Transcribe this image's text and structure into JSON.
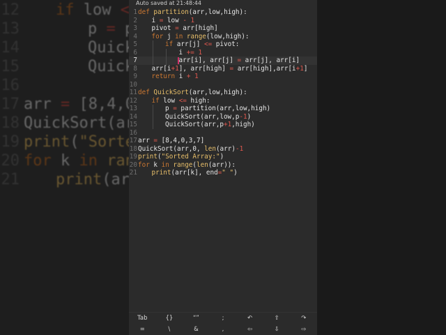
{
  "status": {
    "autosave": "Auto saved at 21:48:44"
  },
  "editor": {
    "active_line": 7,
    "colors": {
      "background": "#2b2b2b",
      "keyword": "#cc7832",
      "function": "#e8bf6a",
      "operator": "#e0584e"
    },
    "lines": [
      {
        "n": "1",
        "indent": 0,
        "tokens": [
          [
            "def ",
            "kw"
          ],
          [
            "partition",
            "fn"
          ],
          [
            "(arr,low,high):",
            ""
          ]
        ]
      },
      {
        "n": "2",
        "indent": 1,
        "tokens": [
          [
            "i ",
            ""
          ],
          [
            "=",
            "op"
          ],
          [
            " low ",
            ""
          ],
          [
            "-",
            "op"
          ],
          [
            " ",
            ""
          ],
          [
            "1",
            "op"
          ]
        ]
      },
      {
        "n": "3",
        "indent": 1,
        "tokens": [
          [
            "pivot ",
            ""
          ],
          [
            "=",
            "op"
          ],
          [
            " arr[high]",
            ""
          ]
        ]
      },
      {
        "n": "4",
        "indent": 1,
        "tokens": [
          [
            "for",
            "kw"
          ],
          [
            " j ",
            ""
          ],
          [
            "in",
            "kw"
          ],
          [
            " ",
            ""
          ],
          [
            "range",
            "fn"
          ],
          [
            "(low,high):",
            ""
          ]
        ]
      },
      {
        "n": "5",
        "indent": 2,
        "tokens": [
          [
            "if",
            "kw"
          ],
          [
            " arr[j] ",
            ""
          ],
          [
            "<=",
            "op"
          ],
          [
            " pivot:",
            ""
          ]
        ]
      },
      {
        "n": "6",
        "indent": 3,
        "tokens": [
          [
            "i ",
            ""
          ],
          [
            "+=",
            "op"
          ],
          [
            " ",
            ""
          ],
          [
            "1",
            "op"
          ]
        ]
      },
      {
        "n": "7",
        "indent": 3,
        "tokens": [
          [
            "arr[i], arr[j] ",
            ""
          ],
          [
            "=",
            "op"
          ],
          [
            " arr[j], arr[i]",
            ""
          ]
        ]
      },
      {
        "n": "8",
        "indent": 1,
        "tokens": [
          [
            "arr[i",
            ""
          ],
          [
            "+",
            "op"
          ],
          [
            "1",
            "op"
          ],
          [
            "], arr[high] ",
            ""
          ],
          [
            "=",
            "op"
          ],
          [
            " arr[high],arr[i",
            ""
          ],
          [
            "+",
            "op"
          ],
          [
            "1",
            "op"
          ],
          [
            "]",
            ""
          ]
        ]
      },
      {
        "n": "9",
        "indent": 1,
        "tokens": [
          [
            "return",
            "kw"
          ],
          [
            " i ",
            ""
          ],
          [
            "+",
            "op"
          ],
          [
            " ",
            ""
          ],
          [
            "1",
            "op"
          ]
        ]
      },
      {
        "n": "10",
        "indent": 0,
        "tokens": []
      },
      {
        "n": "11",
        "indent": 0,
        "tokens": [
          [
            "def ",
            "kw"
          ],
          [
            "QuickSort",
            "fn"
          ],
          [
            "(arr,low,high):",
            ""
          ]
        ]
      },
      {
        "n": "12",
        "indent": 1,
        "tokens": [
          [
            "if",
            "kw"
          ],
          [
            " low ",
            ""
          ],
          [
            "<=",
            "op"
          ],
          [
            " high:",
            ""
          ]
        ]
      },
      {
        "n": "13",
        "indent": 2,
        "tokens": [
          [
            "p ",
            ""
          ],
          [
            "=",
            "op"
          ],
          [
            " partition(arr,low,high)",
            ""
          ]
        ]
      },
      {
        "n": "14",
        "indent": 2,
        "tokens": [
          [
            "QuickSort(arr,low,p",
            ""
          ],
          [
            "-",
            "op"
          ],
          [
            "1",
            "op"
          ],
          [
            ")",
            ""
          ]
        ]
      },
      {
        "n": "15",
        "indent": 2,
        "tokens": [
          [
            "QuickSort(arr,p",
            ""
          ],
          [
            "+",
            "op"
          ],
          [
            "1",
            "op"
          ],
          [
            ",high)",
            ""
          ]
        ]
      },
      {
        "n": "16",
        "indent": 0,
        "tokens": []
      },
      {
        "n": "17",
        "indent": 0,
        "tokens": [
          [
            "arr ",
            ""
          ],
          [
            "=",
            "op"
          ],
          [
            " [8,4,0,3,7]",
            ""
          ]
        ]
      },
      {
        "n": "18",
        "indent": 0,
        "tokens": [
          [
            "QuickSort(arr,0, ",
            ""
          ],
          [
            "len",
            "fn"
          ],
          [
            "(arr)",
            ""
          ],
          [
            "-",
            "op"
          ],
          [
            "1",
            "op"
          ]
        ]
      },
      {
        "n": "19",
        "indent": 0,
        "tokens": [
          [
            "print",
            "fn"
          ],
          [
            "(",
            ""
          ],
          [
            "\"Sorted Array:\"",
            "str"
          ],
          [
            ")",
            ""
          ]
        ]
      },
      {
        "n": "20",
        "indent": 0,
        "tokens": [
          [
            "for",
            "kw"
          ],
          [
            " k ",
            ""
          ],
          [
            "in",
            "kw"
          ],
          [
            " ",
            ""
          ],
          [
            "range",
            "fn"
          ],
          [
            "(",
            ""
          ],
          [
            "len",
            "fn"
          ],
          [
            "(arr)):",
            ""
          ]
        ]
      },
      {
        "n": "21",
        "indent": 1,
        "tokens": [
          [
            "print",
            "fn"
          ],
          [
            "(arr[k], end",
            ""
          ],
          [
            "=",
            "op"
          ],
          [
            "\" \"",
            "str"
          ],
          [
            ")",
            ""
          ]
        ]
      }
    ]
  },
  "keyboard": {
    "row1": [
      {
        "name": "tab-key",
        "label": "Tab"
      },
      {
        "name": "braces-key",
        "label": "{}"
      },
      {
        "name": "quotes-key",
        "label": "“”"
      },
      {
        "name": "semicolon-key",
        "label": ";"
      },
      {
        "name": "undo-key",
        "label": "↶"
      },
      {
        "name": "shift-key",
        "label": "⇧"
      },
      {
        "name": "redo-key",
        "label": "↷"
      }
    ],
    "row2": [
      {
        "name": "equals-key",
        "label": "="
      },
      {
        "name": "backslash-key",
        "label": "\\"
      },
      {
        "name": "ampersand-key",
        "label": "&"
      },
      {
        "name": "comma-key",
        "label": ","
      },
      {
        "name": "arrow-left-key",
        "label": "⇦"
      },
      {
        "name": "arrow-down-key",
        "label": "⇩"
      },
      {
        "name": "arrow-right-key",
        "label": "⇨"
      }
    ]
  }
}
